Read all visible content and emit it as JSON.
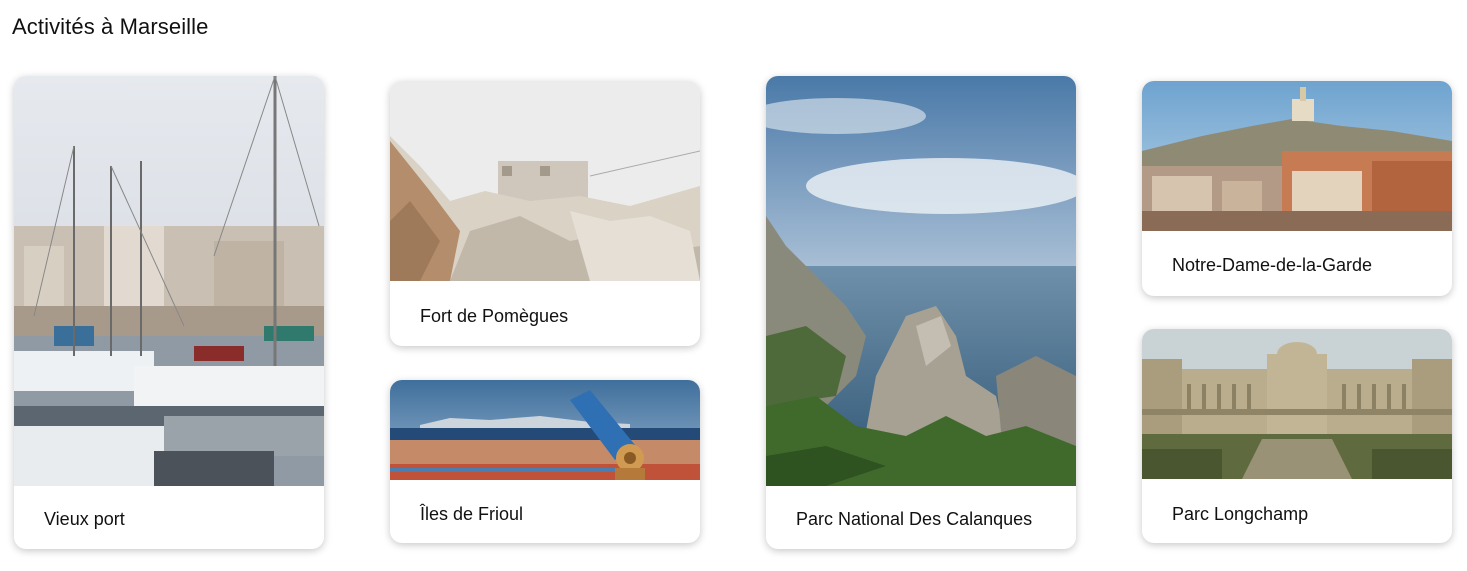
{
  "page": {
    "title": "Activités à Marseille"
  },
  "activities": [
    {
      "name": "Vieux port"
    },
    {
      "name": "Fort de Pomègues"
    },
    {
      "name": "Îles de Frioul"
    },
    {
      "name": "Parc National Des Calanques"
    },
    {
      "name": "Notre-Dame-de-la-Garde"
    },
    {
      "name": "Parc Longchamp"
    }
  ]
}
